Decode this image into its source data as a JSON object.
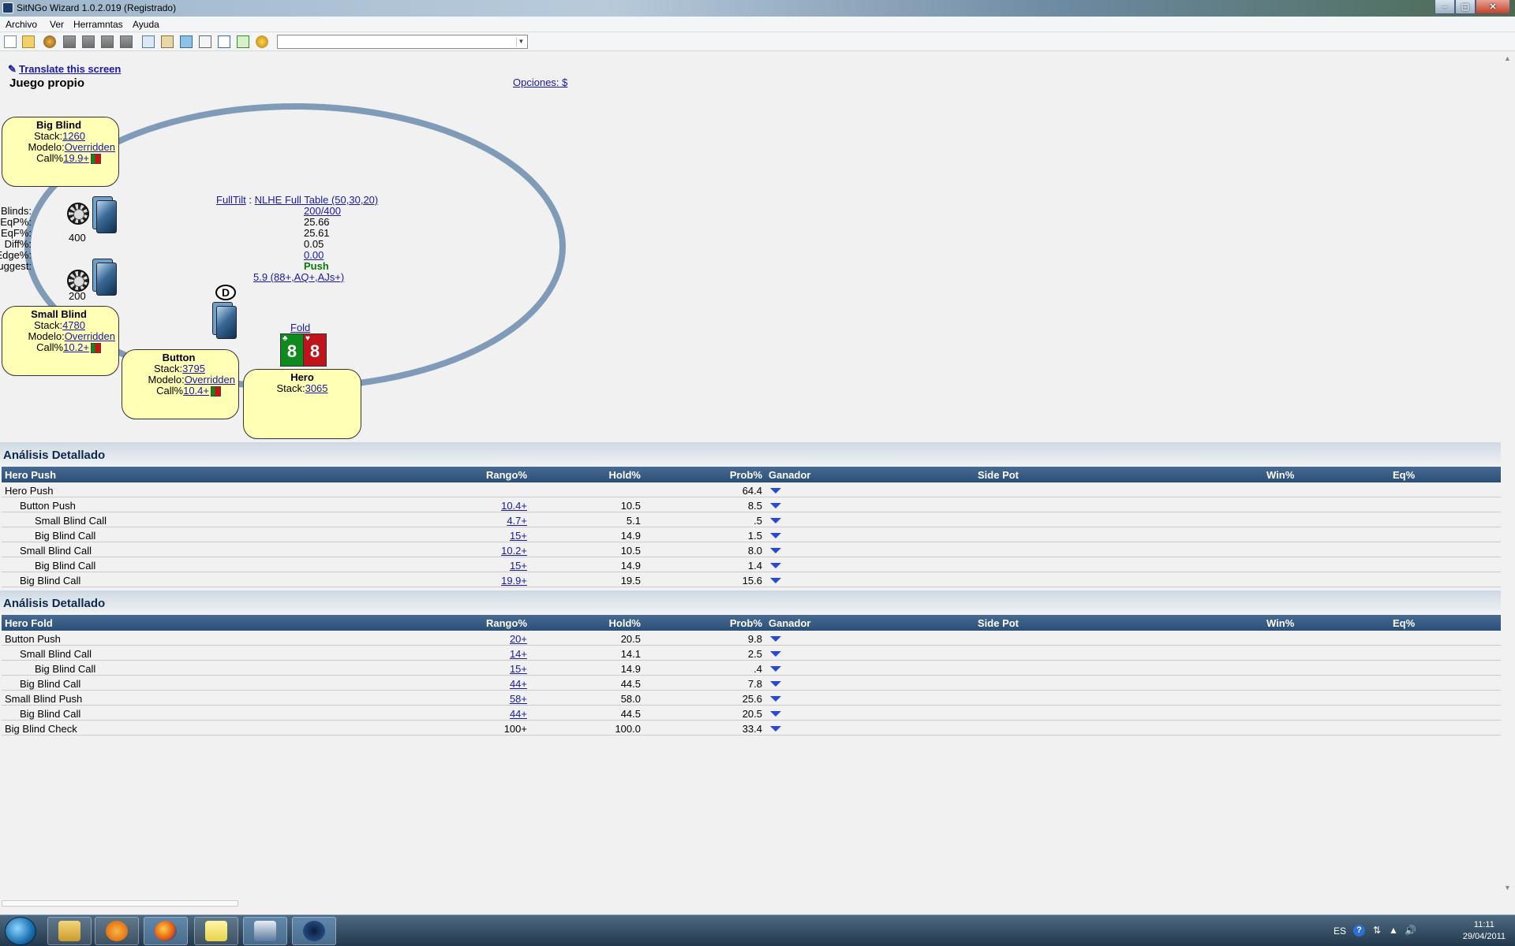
{
  "window": {
    "title": "SitNGo Wizard 1.0.2.019 (Registrado)"
  },
  "menu": [
    "Archivo",
    "Ver",
    "Herramntas",
    "Ayuda"
  ],
  "translate_link": "Translate this screen",
  "page_title": "Juego propio",
  "options_link": "Opciones: $",
  "seats": {
    "big_blind": {
      "name": "Big Blind",
      "stack_label": "Stack:",
      "stack": "1260",
      "model_label": "Modelo:",
      "model": "Overridden",
      "call_label": "Call%",
      "call": "19.9+"
    },
    "small_blind": {
      "name": "Small Blind",
      "stack_label": "Stack:",
      "stack": "4780",
      "model_label": "Modelo:",
      "model": "Overridden",
      "call_label": "Call%",
      "call": "10.2+"
    },
    "button": {
      "name": "Button",
      "stack_label": "Stack:",
      "stack": "3795",
      "model_label": "Modelo:",
      "model": "Overridden",
      "call_label": "Call%",
      "call": "10.4+"
    },
    "hero": {
      "name": "Hero",
      "stack_label": "Stack:",
      "stack": "3065",
      "action": "Fold",
      "cards": [
        "8",
        "8"
      ],
      "card_suits": [
        "♣",
        "♥"
      ]
    }
  },
  "pots": {
    "big_blind_bet": "400",
    "small_blind_bet": "200",
    "dealer_label": "D"
  },
  "center": {
    "site": "FullTilt",
    "sep": ":",
    "game": "NLHE Full Table (50,30,20)",
    "blinds_label": "Blinds:",
    "blinds": "200/400",
    "eqp_label": "EqP%:",
    "eqp": "25.66",
    "eqf_label": "EqF%:",
    "eqf": "25.61",
    "diff_label": "Diff%:",
    "diff": "0.05",
    "edge_label": "Edge%:",
    "edge": "0.00",
    "suggest_label": "Suggest:",
    "suggest": "Push",
    "range": "5.9 (88+,AQ+,AJs+)"
  },
  "columns": {
    "rango": "Rango%",
    "hold": "Hold%",
    "prob": "Prob%",
    "ganador": "Ganador",
    "side": "Side Pot",
    "win": "Win%",
    "eq": "Eq%"
  },
  "analysis_push": {
    "title": "Análisis Detallado",
    "header": "Hero Push",
    "rows": [
      {
        "name": "Hero Push",
        "indent": 0,
        "rango": "",
        "hold": "",
        "prob": "64.4",
        "link": false
      },
      {
        "name": "Button Push",
        "indent": 1,
        "rango": "10.4+",
        "hold": "10.5",
        "prob": "8.5",
        "link": true
      },
      {
        "name": "Small Blind Call",
        "indent": 2,
        "rango": "4.7+",
        "hold": "5.1",
        "prob": ".5",
        "link": true
      },
      {
        "name": "Big Blind Call",
        "indent": 2,
        "rango": "15+",
        "hold": "14.9",
        "prob": "1.5",
        "link": true
      },
      {
        "name": "Small Blind Call",
        "indent": 1,
        "rango": "10.2+",
        "hold": "10.5",
        "prob": "8.0",
        "link": true
      },
      {
        "name": "Big Blind Call",
        "indent": 2,
        "rango": "15+",
        "hold": "14.9",
        "prob": "1.4",
        "link": true
      },
      {
        "name": "Big Blind Call",
        "indent": 1,
        "rango": "19.9+",
        "hold": "19.5",
        "prob": "15.6",
        "link": true
      }
    ]
  },
  "analysis_fold": {
    "title": "Análisis Detallado",
    "header": "Hero Fold",
    "rows": [
      {
        "name": "Button Push",
        "indent": 0,
        "rango": "20+",
        "hold": "20.5",
        "prob": "9.8",
        "link": true
      },
      {
        "name": "Small Blind Call",
        "indent": 1,
        "rango": "14+",
        "hold": "14.1",
        "prob": "2.5",
        "link": true
      },
      {
        "name": "Big Blind Call",
        "indent": 2,
        "rango": "15+",
        "hold": "14.9",
        "prob": ".4",
        "link": true
      },
      {
        "name": "Big Blind Call",
        "indent": 1,
        "rango": "44+",
        "hold": "44.5",
        "prob": "7.8",
        "link": true
      },
      {
        "name": "Small Blind Push",
        "indent": 0,
        "rango": "58+",
        "hold": "58.0",
        "prob": "25.6",
        "link": true
      },
      {
        "name": "Big Blind Call",
        "indent": 1,
        "rango": "44+",
        "hold": "44.5",
        "prob": "20.5",
        "link": true
      },
      {
        "name": "Big Blind Check",
        "indent": 0,
        "rango": "100+",
        "hold": "100.0",
        "prob": "33.4",
        "link": false
      }
    ]
  },
  "taskbar": {
    "lang": "ES",
    "time": "11:11",
    "date": "29/04/2011"
  },
  "colors": {
    "header_blue": "#2a4f78",
    "seat_yellow": "#ffffb5",
    "table_ring": "#7f9bb8",
    "link": "#1a1aa6",
    "push_green": "#0b7a0b"
  }
}
